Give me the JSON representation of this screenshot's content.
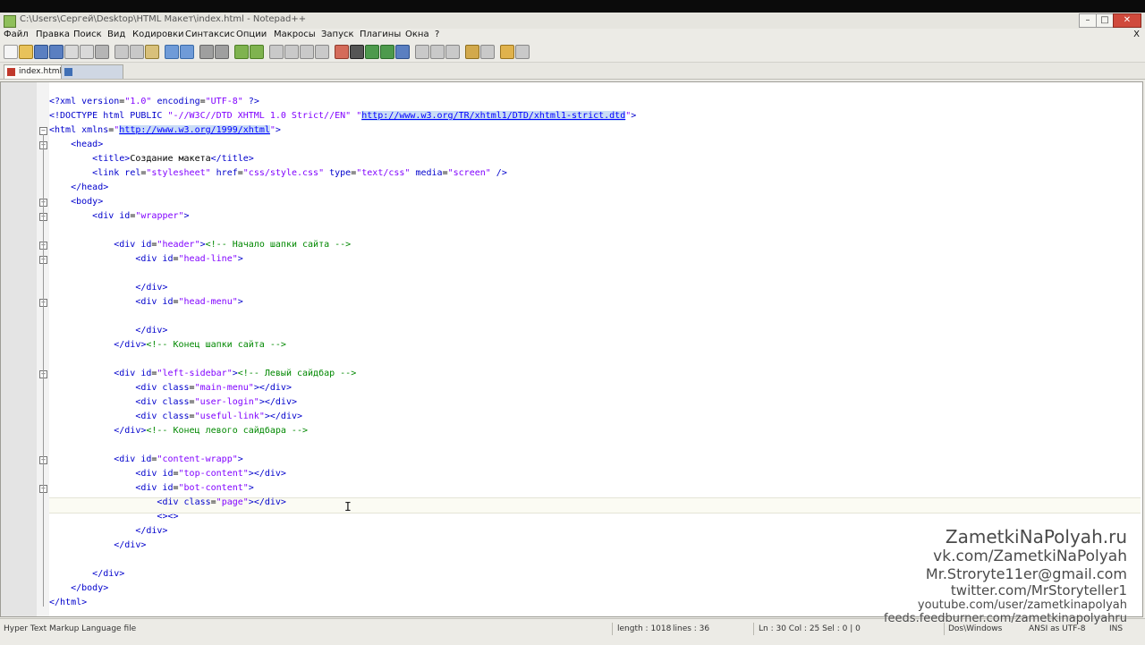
{
  "window": {
    "title": "C:\\Users\\Сергей\\Desktop\\HTML Макет\\index.html - Notepad++"
  },
  "menu": [
    "Файл",
    "Правка",
    "Поиск",
    "Вид",
    "Кодировки",
    "Синтаксис",
    "Опции",
    "Макросы",
    "Запуск",
    "Плагины",
    "Окна",
    "?"
  ],
  "menu_close": "X",
  "tabs": [
    {
      "label": "index.html",
      "active": true
    },
    {
      "label": "",
      "active": false
    }
  ],
  "editor": {
    "lines": [
      "<?xml version=\"1.0\" encoding=\"UTF-8\" ?>",
      "<!DOCTYPE html PUBLIC \"-//W3C//DTD XHTML 1.0 Strict//EN\" \"http://www.w3.org/TR/xhtml1/DTD/xhtml1-strict.dtd\">",
      "<html xmlns=\"http://www.w3.org/1999/xhtml\">",
      "    <head>",
      "        <title>Создание макета</title>",
      "        <link rel=\"stylesheet\" href=\"css/style.css\" type=\"text/css\" media=\"screen\" />",
      "    </head>",
      "    <body>",
      "        <div id=\"wrapper\">",
      "",
      "            <div id=\"header\"><!-- Начало шапки сайта -->",
      "                <div id=\"head-line\">",
      "",
      "                </div>",
      "                <div id=\"head-menu\">",
      "",
      "                </div>",
      "            </div><!-- Конец шапки сайта -->",
      "",
      "            <div id=\"left-sidebar\"><!-- Левый сайдбар -->",
      "                <div class=\"main-menu\"></div>",
      "                <div class=\"user-login\"></div>",
      "                <div class=\"useful-link\"></div>",
      "            </div><!-- Конец левого сайдбара -->",
      "",
      "            <div id=\"content-wrapp\">",
      "                <div id=\"top-content\"></div>",
      "                <div id=\"bot-content\">",
      "                    <div class=\"page\"></div>",
      "                    <><>",
      "                </div>",
      "            </div>",
      "",
      "        </div>",
      "    </body>",
      "</html>"
    ],
    "current_line": 30
  },
  "status": {
    "file_type": "Hyper Text Markup Language file",
    "length": "length : 1018",
    "lines": "lines : 36",
    "position": "Ln : 30    Col : 25    Sel : 0 | 0",
    "eol": "Dos\\Windows",
    "encoding": "ANSI as UTF-8",
    "mode": "INS"
  },
  "watermark": {
    "site": "ZametkiNaPolyah.ru",
    "vk": "vk.com/ZametkiNaPolyah",
    "email": "Mr.Stroryte11er@gmail.com",
    "twitter": "twitter.com/MrStoryteller1",
    "youtube": "youtube.com/user/zametkinapolyah",
    "feeds": "feeds.feedburner.com/zametkinapolyahru"
  }
}
